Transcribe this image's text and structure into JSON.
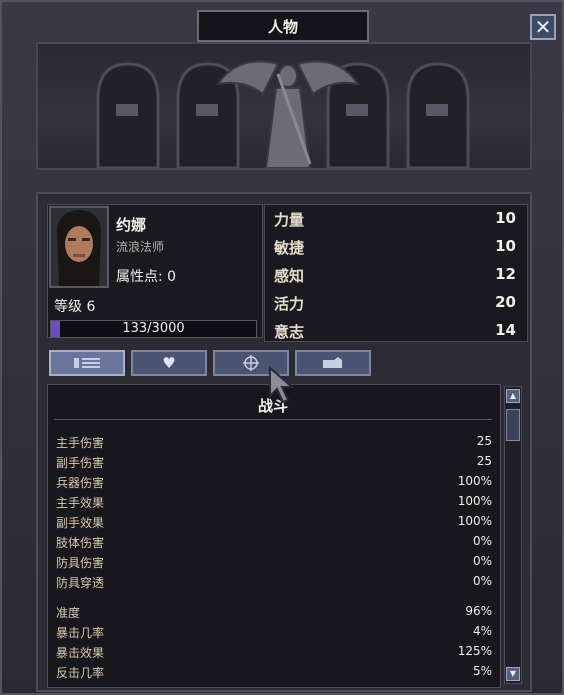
{
  "window": {
    "title": "人物",
    "close_icon": "close-icon"
  },
  "character": {
    "name": "约娜",
    "class": "流浪法师",
    "attr_points_label": "属性点: ",
    "attr_points": "0",
    "level_label": "等级",
    "level": "6",
    "xp_text": "133/3000",
    "xp_fraction": 0.044
  },
  "attributes": [
    {
      "name": "力量",
      "value": "10"
    },
    {
      "name": "敏捷",
      "value": "10"
    },
    {
      "name": "感知",
      "value": "12"
    },
    {
      "name": "活力",
      "value": "20"
    },
    {
      "name": "意志",
      "value": "14"
    }
  ],
  "tabs": [
    {
      "icon": "list-icon",
      "active": true
    },
    {
      "icon": "heart-icon",
      "active": false
    },
    {
      "icon": "crosshair-icon",
      "active": false
    },
    {
      "icon": "hand-icon",
      "active": false
    }
  ],
  "combat": {
    "title": "战斗",
    "group1": [
      {
        "name": "主手伤害",
        "value": "25"
      },
      {
        "name": "副手伤害",
        "value": "25"
      },
      {
        "name": "兵器伤害",
        "value": "100%"
      },
      {
        "name": "主手效果",
        "value": "100%"
      },
      {
        "name": "副手效果",
        "value": "100%"
      },
      {
        "name": "肢体伤害",
        "value": "0%"
      },
      {
        "name": "防具伤害",
        "value": "0%"
      },
      {
        "name": "防具穿透",
        "value": "0%"
      }
    ],
    "group2": [
      {
        "name": "准度",
        "value": "96%"
      },
      {
        "name": "暴击几率",
        "value": "4%"
      },
      {
        "name": "暴击效果",
        "value": "125%"
      },
      {
        "name": "反击几率",
        "value": "5%"
      }
    ]
  },
  "colors": {
    "xp_fill": "#6a4fc0",
    "tab": "#4b5472",
    "background": "#2d2c35"
  }
}
